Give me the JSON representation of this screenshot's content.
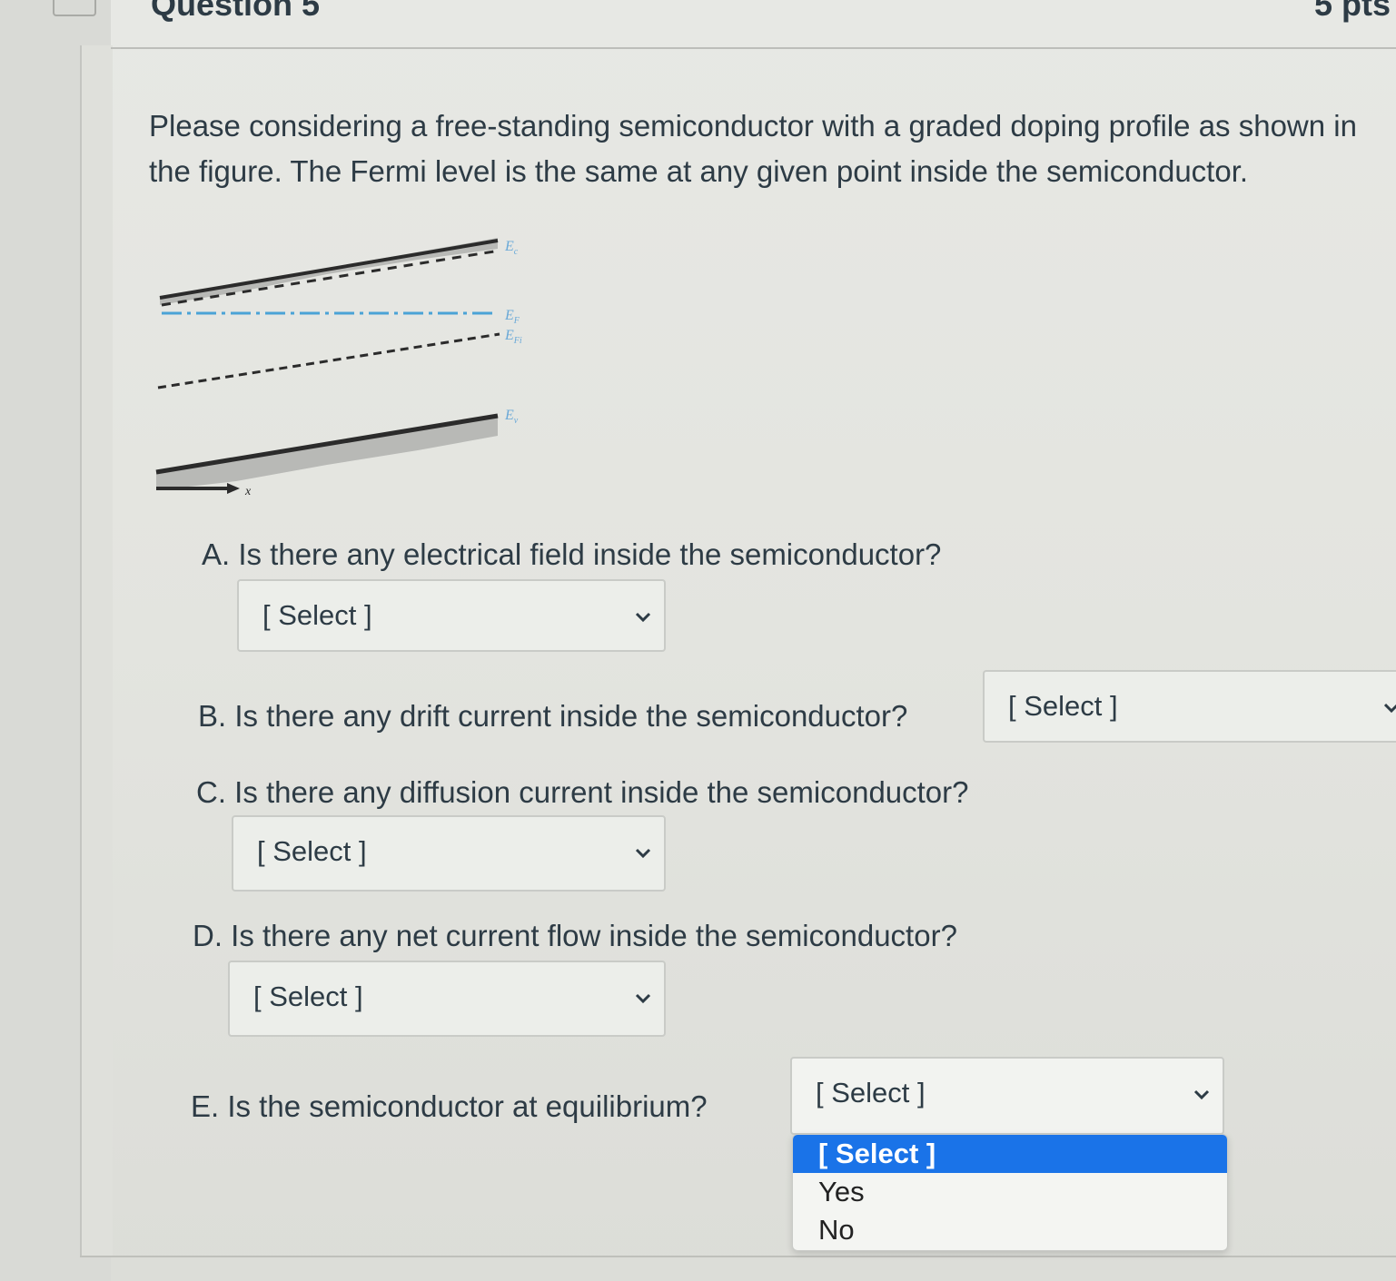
{
  "header": {
    "title": "Question 5",
    "points": "5 pts"
  },
  "prompt": "Please considering a free-standing semiconductor with a graded doping profile as shown in the figure. The Fermi level is the same at any given point inside the semiconductor.",
  "figure": {
    "labels": {
      "ec": "E",
      "ec_sub": "c",
      "ef": "E",
      "ef_sub": "F",
      "efi": "E",
      "efi_sub": "Fi",
      "ev": "E",
      "ev_sub": "v",
      "x": "x"
    },
    "colors": {
      "band": "#2b2b2b",
      "shade": "#b8b9b6",
      "fermi": "#4aa3d6",
      "label": "#6aa9d8"
    }
  },
  "questions": [
    {
      "id": "A",
      "text": "A. Is there any electrical field inside the semiconductor?",
      "select": "[ Select ]"
    },
    {
      "id": "B",
      "text": "B. Is there any drift current inside the semiconductor?",
      "select": "[ Select ]"
    },
    {
      "id": "C",
      "text": "C. Is there any diffusion current inside the semiconductor?",
      "select": "[ Select ]"
    },
    {
      "id": "D",
      "text": "D. Is there any net current flow inside the semiconductor?",
      "select": "[ Select ]"
    },
    {
      "id": "E",
      "text": "E. Is the semiconductor at equilibrium?",
      "select": "[ Select ]"
    }
  ],
  "dropdown": {
    "options": [
      "[ Select ]",
      "Yes",
      "No"
    ],
    "highlighted_index": 0,
    "highlight_color": "#1a73e8"
  }
}
